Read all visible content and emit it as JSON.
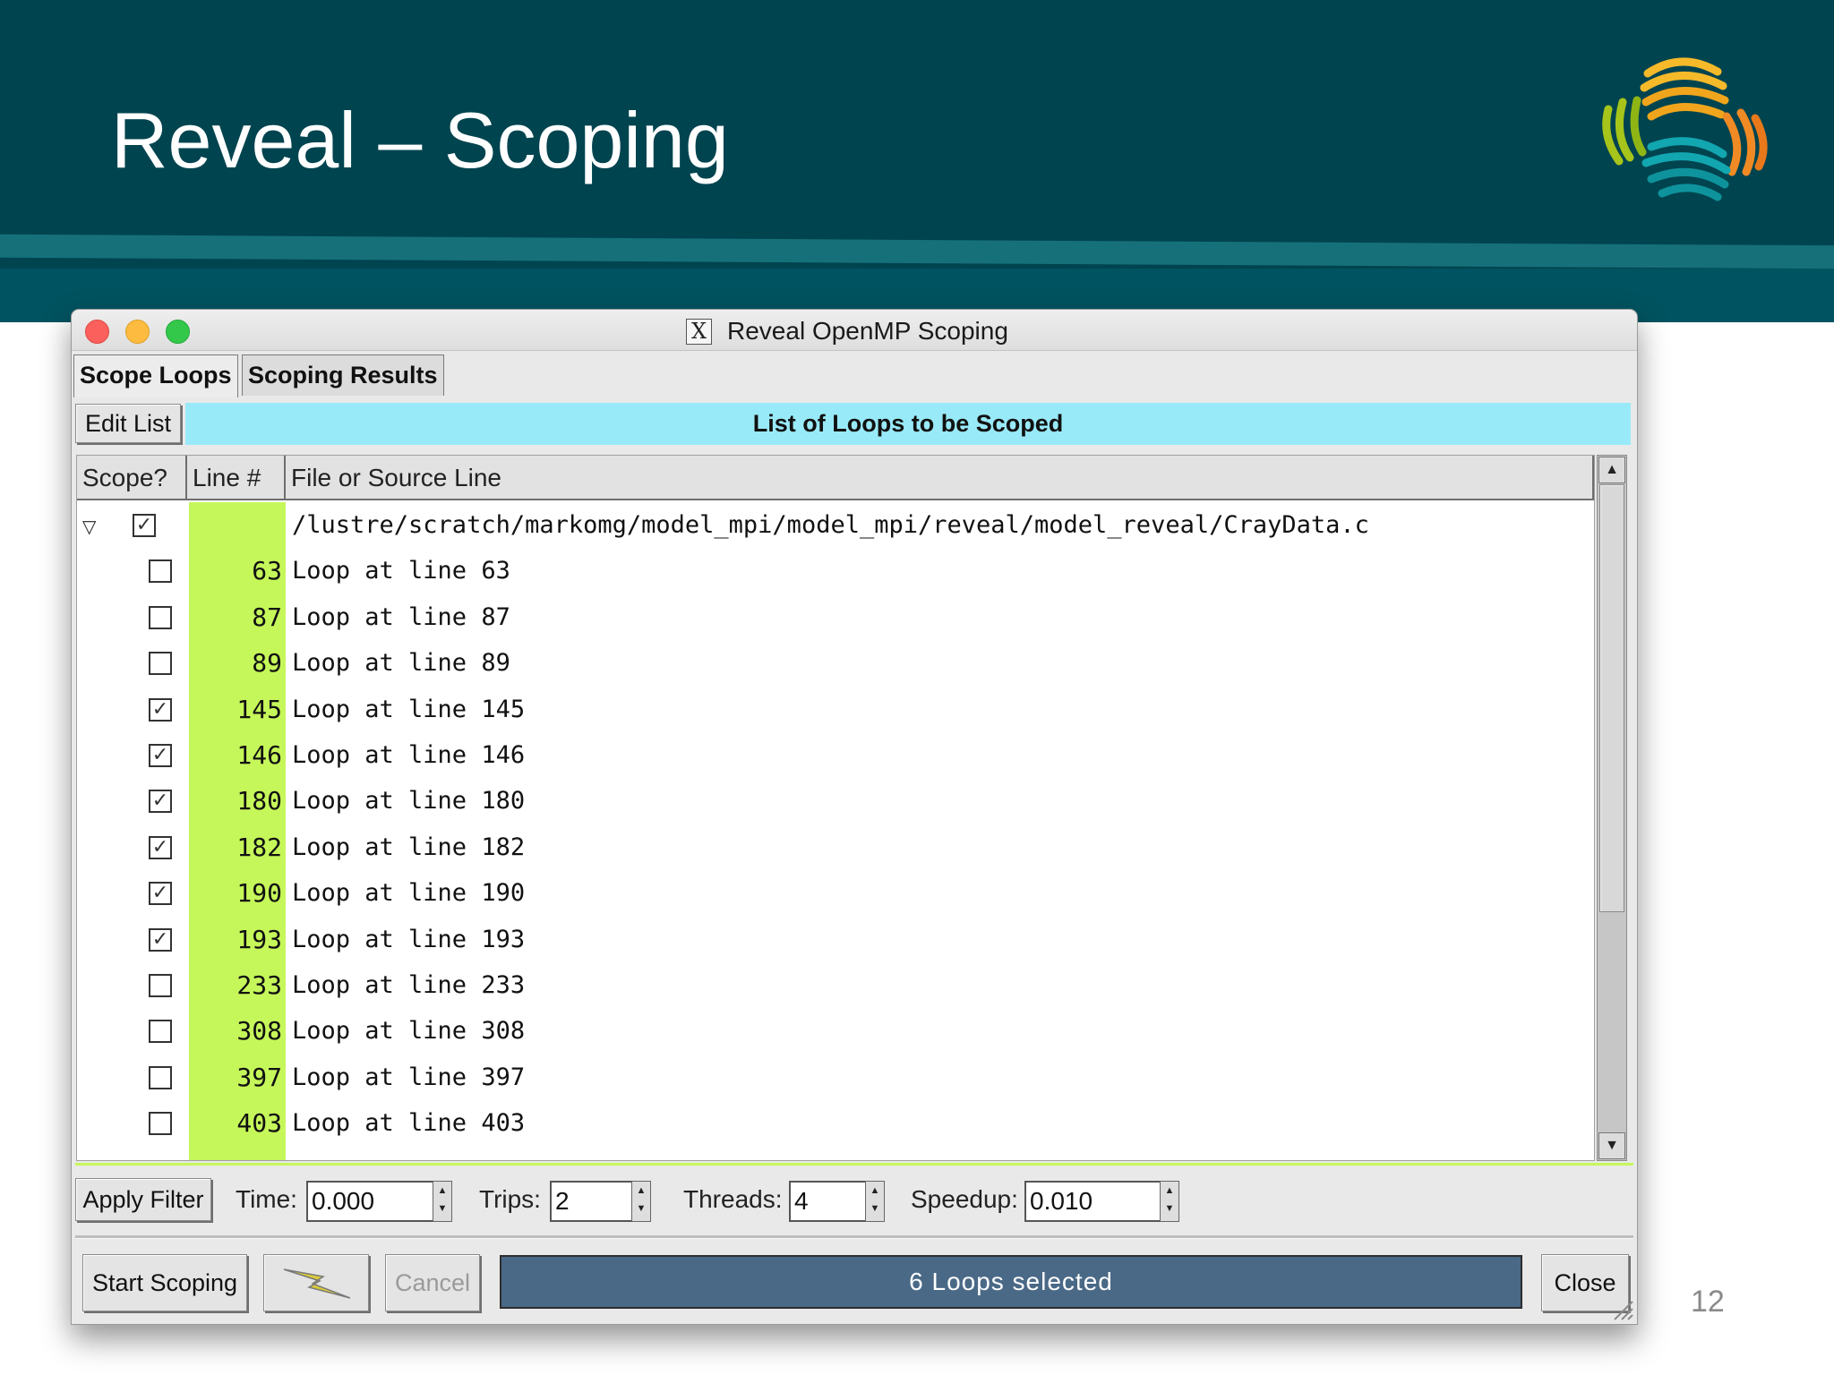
{
  "slide": {
    "title": "Reveal – Scoping",
    "page_number": "12"
  },
  "window": {
    "title": "Reveal OpenMP Scoping",
    "title_icon_glyph": "X"
  },
  "tabs": [
    {
      "label": "Scope Loops",
      "active": true
    },
    {
      "label": "Scoping Results",
      "active": false
    }
  ],
  "toolbar": {
    "edit_list_label": "Edit List",
    "banner": "List of Loops to be Scoped"
  },
  "table": {
    "headers": [
      "Scope?",
      "Line #",
      "File or Source Line"
    ],
    "file": {
      "path": "/lustre/scratch/markomg/model_mpi/model_mpi/reveal/model_reveal/CrayData.c",
      "checked": true,
      "expanded": true
    },
    "rows": [
      {
        "line": "63",
        "text": "Loop at line 63",
        "checked": false
      },
      {
        "line": "87",
        "text": "Loop at line 87",
        "checked": false
      },
      {
        "line": "89",
        "text": "Loop at line 89",
        "checked": false
      },
      {
        "line": "145",
        "text": "Loop at line 145",
        "checked": true
      },
      {
        "line": "146",
        "text": "Loop at line 146",
        "checked": true
      },
      {
        "line": "180",
        "text": "Loop at line 180",
        "checked": true
      },
      {
        "line": "182",
        "text": "Loop at line 182",
        "checked": true
      },
      {
        "line": "190",
        "text": "Loop at line 190",
        "checked": true
      },
      {
        "line": "193",
        "text": "Loop at line 193",
        "checked": true
      },
      {
        "line": "233",
        "text": "Loop at line 233",
        "checked": false
      },
      {
        "line": "308",
        "text": "Loop at line 308",
        "checked": false
      },
      {
        "line": "397",
        "text": "Loop at line 397",
        "checked": false
      },
      {
        "line": "403",
        "text": "Loop at line 403",
        "checked": false
      }
    ]
  },
  "filter": {
    "apply_label": "Apply Filter",
    "time_label": "Time:",
    "time_value": "0.000",
    "trips_label": "Trips:",
    "trips_value": "2",
    "threads_label": "Threads:",
    "threads_value": "4",
    "speedup_label": "Speedup:",
    "speedup_value": "0.010"
  },
  "actions": {
    "start_label": "Start Scoping",
    "cancel_label": "Cancel",
    "status": "6 Loops selected",
    "close_label": "Close"
  },
  "colors": {
    "header_bg": "#00444f",
    "banner_bg": "#99eaf8",
    "line_col_bg": "#c6f75a",
    "status_bg": "#4a6987"
  },
  "icons": {
    "check_glyph": "✓",
    "expander_glyph": "▽",
    "spin_up_glyph": "▲",
    "spin_down_glyph": "▼"
  }
}
